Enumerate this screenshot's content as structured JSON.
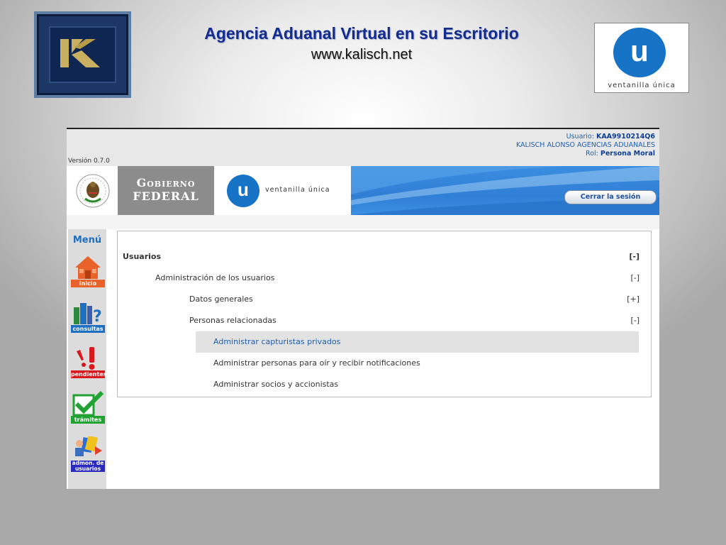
{
  "slide": {
    "title": "Agencia Aduanal Virtual en su Escritorio",
    "url": "www.kalisch.net",
    "vu_logo_letter": "u",
    "vu_logo_caption": "ventanilla única"
  },
  "app": {
    "version": "Versión 0.7.0",
    "user": {
      "usuario_label": "Usuario: ",
      "usuario_value": "KAA9910214Q6",
      "company": "KALISCH ALONSO AGENCIAS ADUANALES",
      "rol_label": "Rol: ",
      "rol_value": "Persona Moral"
    },
    "banner": {
      "gob_line1": "Gobierno",
      "gob_line2": "FEDERAL",
      "vu_letter": "u",
      "vu_caption": "ventanilla única",
      "logout_label": "Cerrar la sesión"
    },
    "sidebar": {
      "title": "Menú",
      "items": [
        {
          "label": "inicio",
          "color": "#e8622a"
        },
        {
          "label": "consultas",
          "color": "#1e6fc0"
        },
        {
          "label": "pendientes",
          "color": "#d8181c"
        },
        {
          "label": "trámites",
          "color": "#22a232"
        },
        {
          "label": "admon. de usuarios",
          "color": "#2a2ac0"
        }
      ]
    },
    "tree": [
      {
        "label": "Usuarios",
        "toggle": "[-]"
      },
      {
        "label": "Administración de los usuarios",
        "toggle": "[-]"
      },
      {
        "label": "Datos generales",
        "toggle": "[+]"
      },
      {
        "label": "Personas relacionadas",
        "toggle": "[-]"
      },
      {
        "label": "Administrar capturistas privados"
      },
      {
        "label": "Administrar personas para oír y recibir notificaciones"
      },
      {
        "label": "Administrar socios y accionistas"
      }
    ]
  }
}
